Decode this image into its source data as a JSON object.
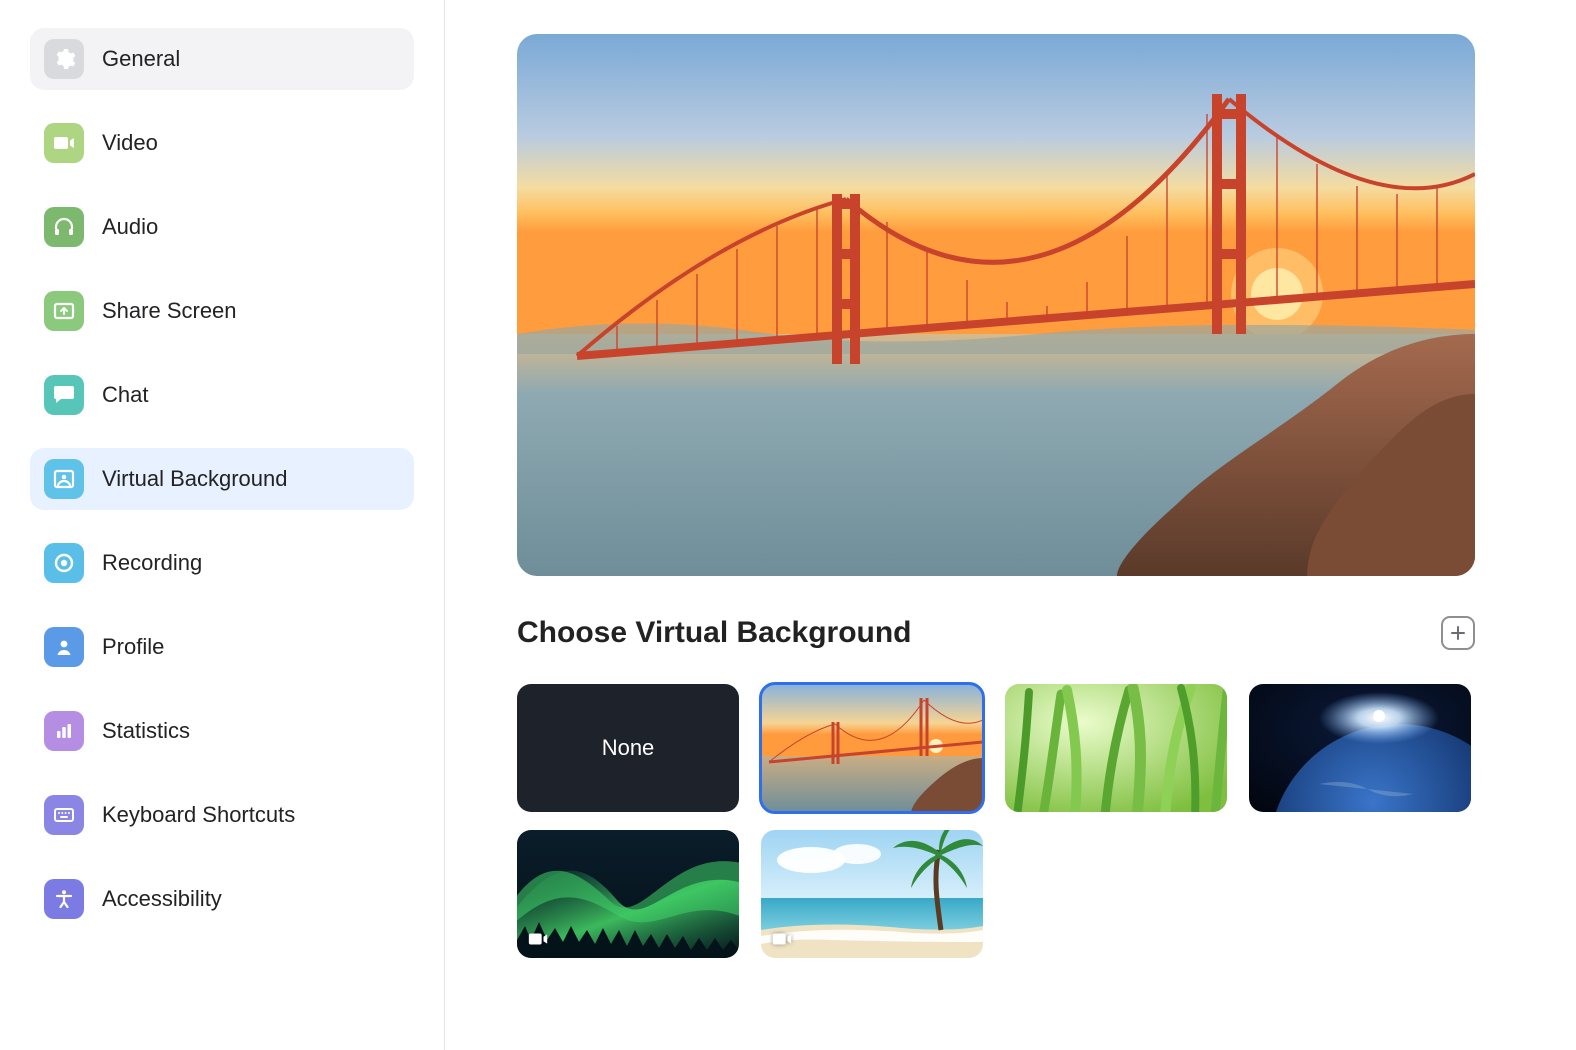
{
  "sidebar": {
    "items": [
      {
        "id": "general",
        "label": "General"
      },
      {
        "id": "video",
        "label": "Video"
      },
      {
        "id": "audio",
        "label": "Audio"
      },
      {
        "id": "share",
        "label": "Share Screen"
      },
      {
        "id": "chat",
        "label": "Chat"
      },
      {
        "id": "vbg",
        "label": "Virtual Background"
      },
      {
        "id": "recording",
        "label": "Recording"
      },
      {
        "id": "profile",
        "label": "Profile"
      },
      {
        "id": "stats",
        "label": "Statistics"
      },
      {
        "id": "keyboard",
        "label": "Keyboard Shortcuts"
      },
      {
        "id": "access",
        "label": "Accessibility"
      }
    ],
    "active_id": "vbg"
  },
  "main": {
    "section_title": "Choose Virtual Background",
    "thumbnails": {
      "none_label": "None",
      "selected_index": 1,
      "items": [
        {
          "kind": "none",
          "label": "None"
        },
        {
          "kind": "bridge",
          "label": "Golden Gate Bridge at sunset"
        },
        {
          "kind": "grass",
          "label": "Green grass closeup"
        },
        {
          "kind": "earth",
          "label": "Earth from space"
        },
        {
          "kind": "aurora",
          "label": "Aurora borealis",
          "video": true
        },
        {
          "kind": "beach",
          "label": "Tropical beach",
          "video": true
        }
      ]
    }
  }
}
